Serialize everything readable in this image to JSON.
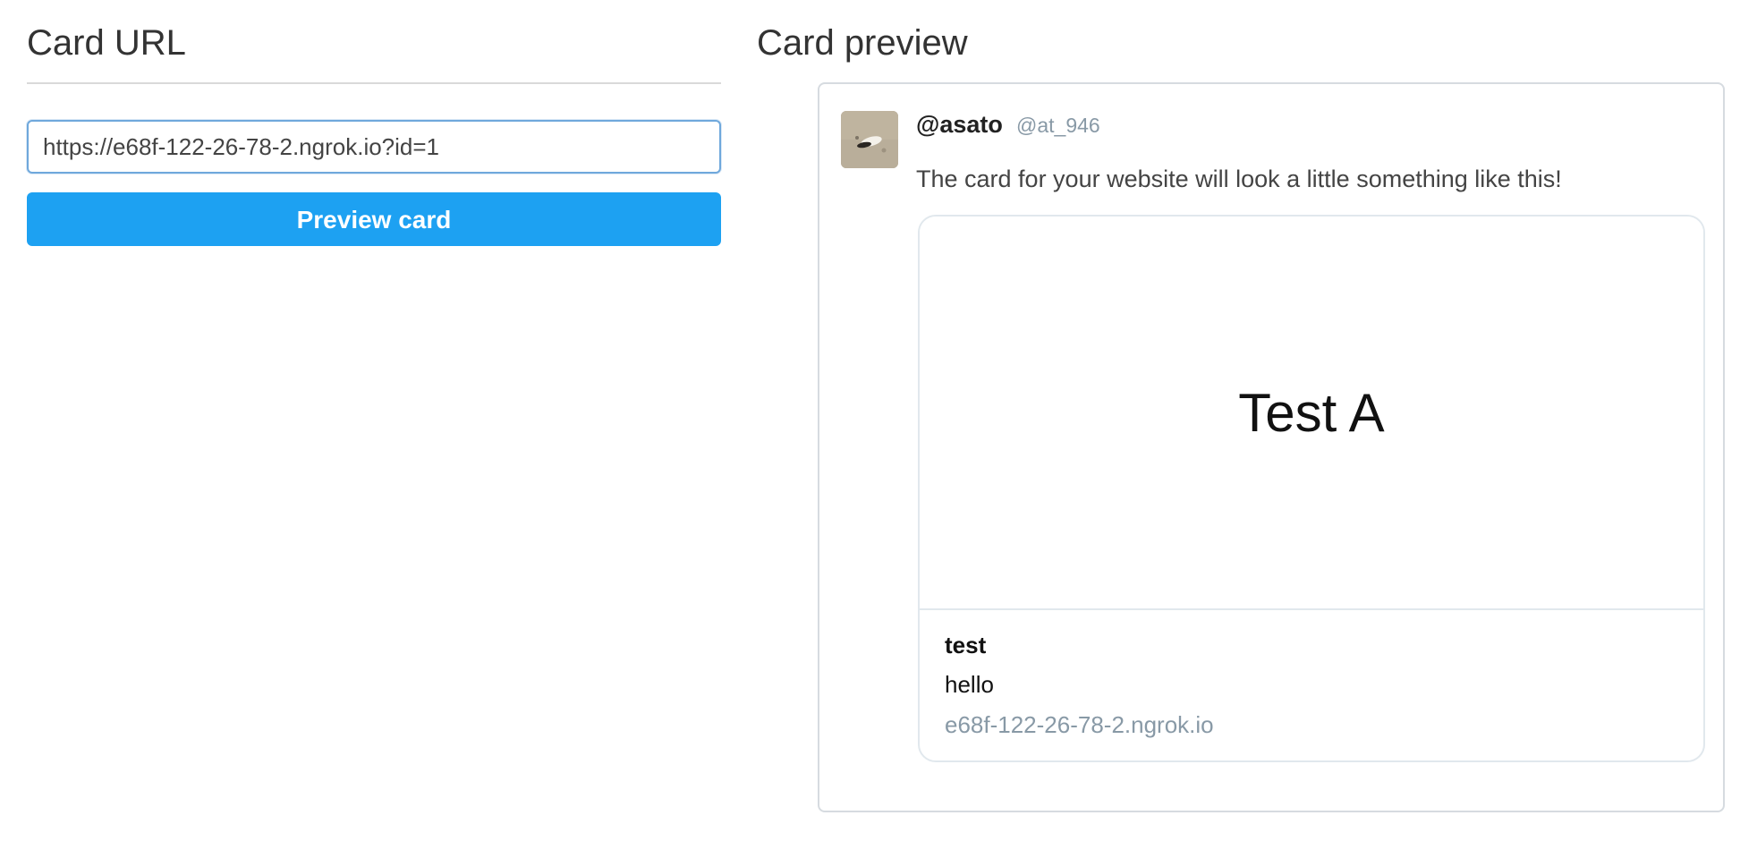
{
  "left": {
    "title": "Card URL",
    "url_input": {
      "value": "https://e68f-122-26-78-2.ngrok.io?id=1",
      "placeholder": ""
    },
    "preview_button_label": "Preview card"
  },
  "right": {
    "title": "Card preview",
    "tweet": {
      "display_name": "@asato",
      "screen_name": "@at_946",
      "text": "The card for your website will look a little something like this!",
      "card": {
        "image_text": "Test A",
        "title": "test",
        "description": "hello",
        "domain": "e68f-122-26-78-2.ngrok.io"
      }
    }
  },
  "colors": {
    "accent_button": "#1da1f2",
    "input_focus_border": "#6fa8dc",
    "muted_text": "#8899a6",
    "card_border": "#e1e8ed"
  },
  "icons": {
    "avatar": "avatar-photo"
  }
}
